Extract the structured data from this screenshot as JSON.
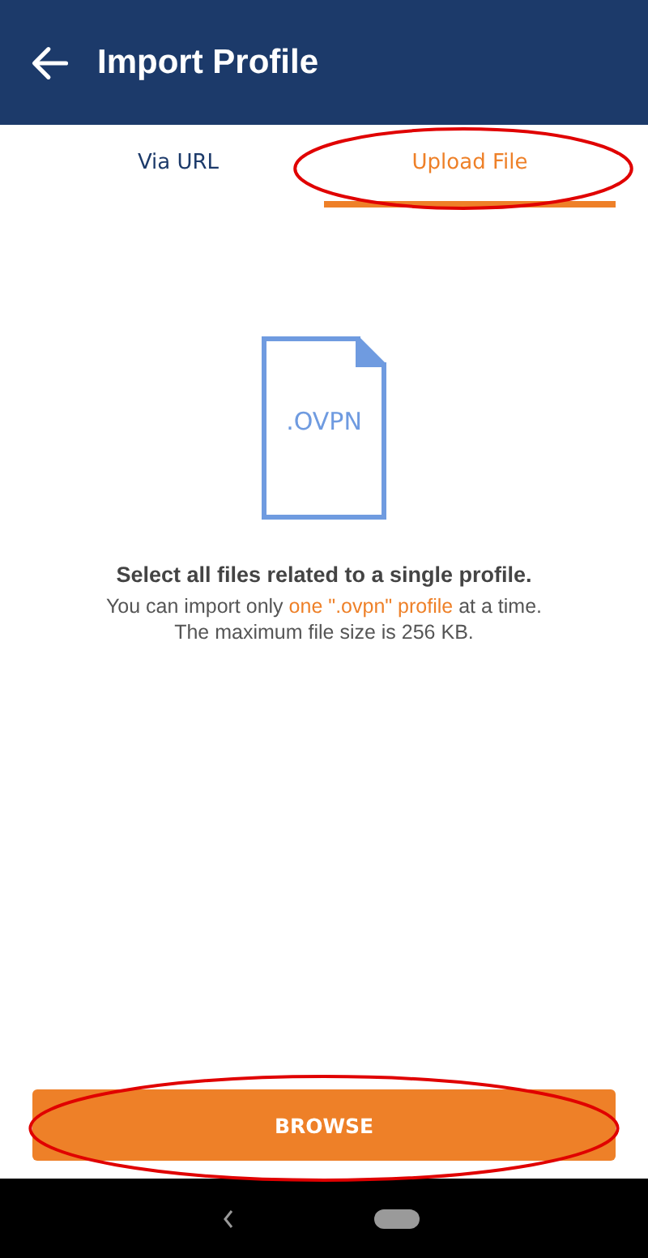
{
  "app_bar": {
    "title": "Import Profile"
  },
  "tabs": [
    {
      "label": "Via URL",
      "selected": false,
      "circled": false
    },
    {
      "label": "Upload File",
      "selected": true,
      "circled": true
    }
  ],
  "file_icon": {
    "label": ".OVPN"
  },
  "heading": "Select all files related to a single profile.",
  "description": [
    {
      "text": "You can import only ",
      "highlight": false
    },
    {
      "text": "one \".ovpn\" profile",
      "highlight": true
    },
    {
      "text": " at a time.",
      "highlight": false
    }
  ],
  "note": "The maximum file size is 256 KB.",
  "browse_button": {
    "label": "BROWSE",
    "circled": true
  }
}
